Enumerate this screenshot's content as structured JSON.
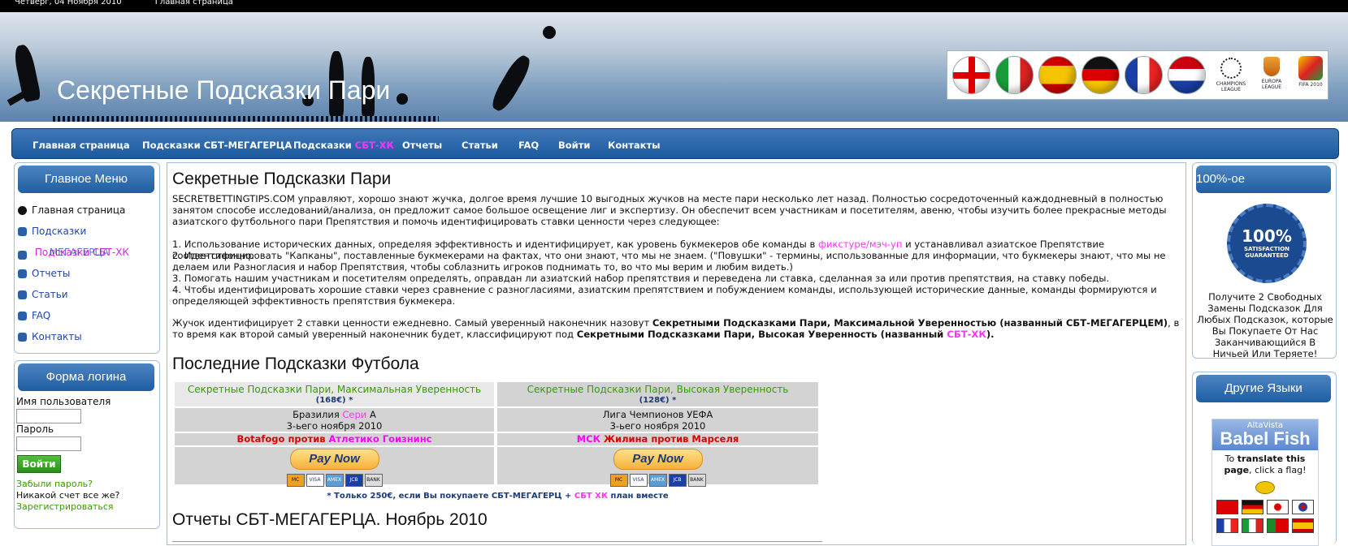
{
  "topbar": {
    "date": "Четверг, 04 Ноября 2010",
    "home_link": "Главная страница"
  },
  "header": {
    "site_title": "Секретные Подсказки Пари"
  },
  "flags": [
    "england-flag",
    "italy-flag",
    "spain-flag",
    "germany-flag",
    "france-flag",
    "netherlands-flag"
  ],
  "badges": [
    {
      "label": "CHAMPIONS LEAGUE"
    },
    {
      "label": "EUROPA LEAGUE"
    },
    {
      "label": "FIFA 2010"
    }
  ],
  "nav": {
    "home": "Главная страница",
    "tips_mega": "Подсказки СБТ-МЕГАГЕРЦА",
    "tips_hk_prefix": "Подсказки ",
    "tips_hk_suffix": "СБТ-ХК",
    "reports": "Отчеты",
    "articles": "Статьи",
    "faq": "FAQ",
    "login": "Войти",
    "contacts": "Контакты"
  },
  "left": {
    "main_menu_title": "Главное Меню",
    "menu": {
      "home": "Главная страница",
      "tips": "Подсказки",
      "tips_overlap_a": "Подсказки СБТ-ХК",
      "tips_overlap_b": "МЕГАГЕРЦА",
      "reports": "Отчеты",
      "articles": "Статьи",
      "faq": "FAQ",
      "contacts": "Контакты"
    },
    "login_title": "Форма логина",
    "username_label": "Имя пользователя",
    "password_label": "Пароль",
    "login_button": "Войти",
    "forgot": "Забыли пароль?",
    "no_account": "Никакой счет все же?",
    "register": "Зарегистрироваться"
  },
  "main": {
    "title": "Секретные Подсказки Пари",
    "intro": "SECRETBETTINGTIPS.COM управляют, хорошо знают жучка, долгое время лучшие 10 выгодных жучков на месте пари несколько лет назад. Полностью сосредоточенный каждодневный в полностью занятом способе исследований/анализа, он предложит самое большое освещение лиг и экспертизу. Он обеспечит всем участникам и посетителям, авеню, чтобы изучить более прекрасные методы азиатского футбольного пари Препятствия и помочь идентифицировать ставки ценности через следующее:",
    "item1_a": "1. Использование исторических данных, определяя эффективность и идентифицирует, как уровень букмекеров обе команды в ",
    "item1_link": "фикстуре/мэч-уп",
    "item1_b": " и устанавливал азиатское Препятствие соответственно.",
    "item2": "2. Идентифицировать \"Капканы\", поставленные букмекерами на фактах, что они знают, что мы не знаем. (\"Повушки\" - термины, использованные для информации, что букмекеры знают, что мы не делаем или Разногласия и набор Препятствия, чтобы соблазнить игроков поднимать то, во что мы верим и любим видеть.)",
    "item3": "3. Помогать нашим участникам и посетителям определять, оправдан ли азиатский набор препятствия и переведена ли ставка, сделанная за или против препятствия, на ставку победы.",
    "item4": "4. Чтобы идентифицировать хорошие ставки через сравнение с разногласиями, азиатским препятствием и побуждением команды, использующей исторические данные, команды формируются и определяющей эффективность препятствия букмекера.",
    "daily_a": "Жучок идентифицирует 2 ставки ценности ежедневно. Самый уверенный наконечник назовут ",
    "daily_b": "Секретными Подсказками Пари, Максимальной Уверенностью (названный СБТ-МЕГАГЕРЦЕМ)",
    "daily_c": ", в то время как второй самый уверенный наконечник будет, классифицируют под ",
    "daily_d": "Секретными Подсказками Пари, Высокая Уверенность (названный ",
    "daily_e": "СБТ-ХК",
    "daily_f": ").",
    "latest_title": "Последние Подсказки Футбола",
    "reports_title": "Отчеты СБТ-МЕГАГЕРЦА. Ноябрь 2010",
    "note_a": "* Только 250€, если Вы покупаете СБТ-МЕГАГЕРЦ + ",
    "note_b": "СБТ ХК",
    "note_c": " план вместе"
  },
  "tips": [
    {
      "title": "Секретные Подсказки Пари, Максимальная Уверенность",
      "price": "(168€) *",
      "league_a": "Бразилия ",
      "league_b": "Сери",
      "league_c": " А",
      "date": "3-ьего ноября 2010",
      "team1": "Botafogo против ",
      "team2": "Атлетико Гоизнинс",
      "pay": "Pay Now"
    },
    {
      "title": "Секретные Подсказки Пари, Высокая Уверенность",
      "price": "(128€) *",
      "league_a": "Лига Чемпионов УЕФА",
      "league_b": "",
      "league_c": "",
      "date": "3-ьего ноября 2010",
      "team1": "МСК ",
      "team2": "Жилина против Марселя",
      "pay": "Pay Now"
    }
  ],
  "cards": [
    "MC",
    "VISA",
    "AMEX",
    "JCB",
    "BANK"
  ],
  "right": {
    "guarantee_title": "100%-ое",
    "seal_big": "100%",
    "seal_small": "SATISFACTION GUARANTEED",
    "guarantee_text": "Получите 2 Свободных Замены Подсказок Для Любых Подсказок, которые Вы Покупаете От Нас Заканчивающийся В Ничьей Или Теряете!",
    "languages_title": "Другие Языки",
    "babel_small": "AltaVista",
    "babel_big": "Babel Fish",
    "babel_text_a": "To ",
    "babel_text_b": "translate this page",
    "babel_text_c": ", click a flag!"
  },
  "colors": {
    "nav_blue": "#1c5a9e",
    "magenta": "#ff33ff",
    "green": "#3a9b00",
    "red": "#dd0000"
  }
}
